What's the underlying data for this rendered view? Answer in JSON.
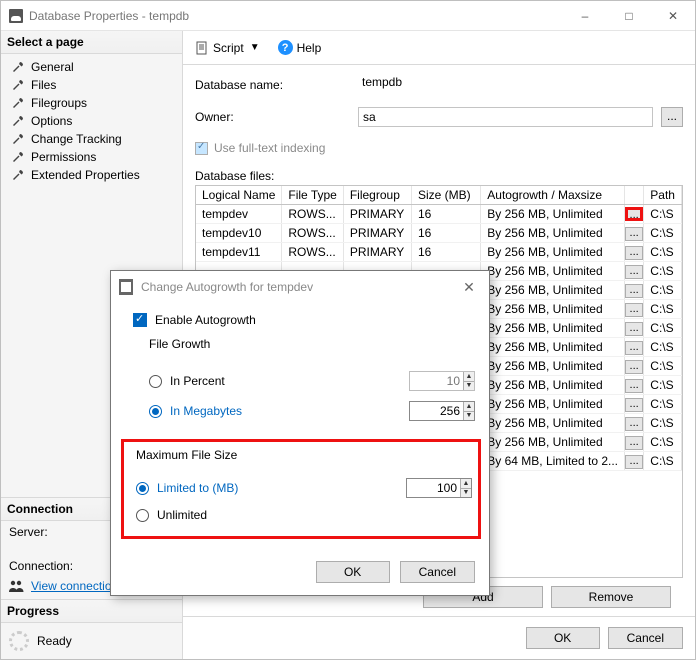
{
  "window": {
    "title": "Database Properties - tempdb"
  },
  "sidebar": {
    "select_page": "Select a page",
    "items": [
      "General",
      "Files",
      "Filegroups",
      "Options",
      "Change Tracking",
      "Permissions",
      "Extended Properties"
    ],
    "connection_header": "Connection",
    "server_label": "Server:",
    "connection_label": "Connection:",
    "view_conn": "View connectio",
    "progress_header": "Progress",
    "progress_state": "Ready"
  },
  "toolbar": {
    "script": "Script",
    "help": "Help"
  },
  "form": {
    "db_name_label": "Database name:",
    "db_name_value": "tempdb",
    "owner_label": "Owner:",
    "owner_value": "sa",
    "fulltext_label": "Use full-text indexing",
    "dbfiles_label": "Database files:"
  },
  "table": {
    "headers": [
      "Logical Name",
      "File Type",
      "Filegroup",
      "Size (MB)",
      "Autogrowth / Maxsize",
      "",
      "Path"
    ],
    "rows": [
      {
        "logical": "tempdev",
        "ftype": "ROWS...",
        "fgroup": "PRIMARY",
        "size": "16",
        "auto": "By 256 MB, Unlimited",
        "path": "C:\\S",
        "hi": true
      },
      {
        "logical": "tempdev10",
        "ftype": "ROWS...",
        "fgroup": "PRIMARY",
        "size": "16",
        "auto": "By 256 MB, Unlimited",
        "path": "C:\\S"
      },
      {
        "logical": "tempdev11",
        "ftype": "ROWS...",
        "fgroup": "PRIMARY",
        "size": "16",
        "auto": "By 256 MB, Unlimited",
        "path": "C:\\S"
      },
      {
        "logical": "",
        "ftype": "",
        "fgroup": "",
        "size": "",
        "auto": "By 256 MB, Unlimited",
        "path": "C:\\S"
      },
      {
        "logical": "",
        "ftype": "",
        "fgroup": "",
        "size": "",
        "auto": "By 256 MB, Unlimited",
        "path": "C:\\S"
      },
      {
        "logical": "",
        "ftype": "",
        "fgroup": "",
        "size": "",
        "auto": "By 256 MB, Unlimited",
        "path": "C:\\S"
      },
      {
        "logical": "",
        "ftype": "",
        "fgroup": "",
        "size": "",
        "auto": "By 256 MB, Unlimited",
        "path": "C:\\S"
      },
      {
        "logical": "",
        "ftype": "",
        "fgroup": "",
        "size": "",
        "auto": "By 256 MB, Unlimited",
        "path": "C:\\S"
      },
      {
        "logical": "",
        "ftype": "",
        "fgroup": "",
        "size": "",
        "auto": "By 256 MB, Unlimited",
        "path": "C:\\S"
      },
      {
        "logical": "",
        "ftype": "",
        "fgroup": "",
        "size": "",
        "auto": "By 256 MB, Unlimited",
        "path": "C:\\S"
      },
      {
        "logical": "",
        "ftype": "",
        "fgroup": "",
        "size": "",
        "auto": "By 256 MB, Unlimited",
        "path": "C:\\S"
      },
      {
        "logical": "",
        "ftype": "",
        "fgroup": "",
        "size": "",
        "auto": "By 256 MB, Unlimited",
        "path": "C:\\S"
      },
      {
        "logical": "",
        "ftype": "",
        "fgroup": "",
        "size": "",
        "auto": "By 256 MB, Unlimited",
        "path": "C:\\S"
      },
      {
        "logical": "",
        "ftype": "",
        "fgroup": "",
        "size": "",
        "auto": "By 64 MB, Limited to 2...",
        "path": "C:\\S"
      }
    ]
  },
  "buttons": {
    "add": "Add",
    "remove": "Remove",
    "ok": "OK",
    "cancel": "Cancel"
  },
  "dialog": {
    "title": "Change Autogrowth for tempdev",
    "enable_label": "Enable Autogrowth",
    "filegrowth_label": "File Growth",
    "in_percent": "In Percent",
    "in_mb": "In Megabytes",
    "percent_value": "10",
    "mb_value": "256",
    "maxsize_label": "Maximum File Size",
    "limited_label": "Limited to (MB)",
    "limited_value": "100",
    "unlimited_label": "Unlimited",
    "ok": "OK",
    "cancel": "Cancel"
  }
}
